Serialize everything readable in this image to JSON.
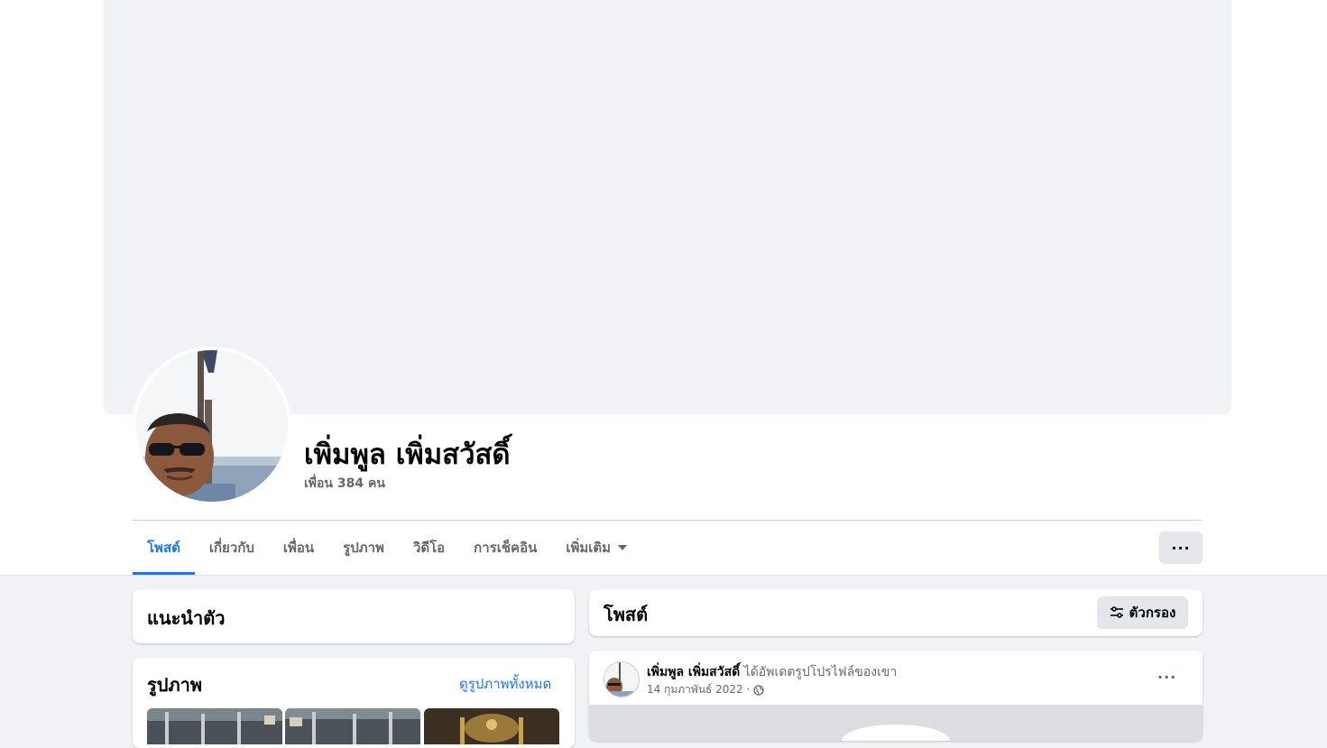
{
  "profile": {
    "name": "เพิ่มพูล เพิ่มสวัสดิ์",
    "friends": "เพื่อน 384 คน"
  },
  "tabs": [
    {
      "label": "โพสต์",
      "active": true
    },
    {
      "label": "เกี่ยวกับ",
      "active": false
    },
    {
      "label": "เพื่อน",
      "active": false
    },
    {
      "label": "รูปภาพ",
      "active": false
    },
    {
      "label": "วิดีโอ",
      "active": false
    },
    {
      "label": "การเช็คอิน",
      "active": false
    },
    {
      "label": "เพิ่มเติม",
      "active": false
    }
  ],
  "more_button": "···",
  "intro": {
    "title": "แนะนำตัว"
  },
  "photos": {
    "title": "รูปภาพ",
    "see_all": "ดูรูปภาพทั้งหมด"
  },
  "posts_header": {
    "title": "โพสต์",
    "filter_label": "ตัวกรอง"
  },
  "post": {
    "author": "เพิ่มพูล เพิ่มสวัสดิ์",
    "action": "ได้อัพเดตรูปโปรไฟล์ของเขา",
    "date": "14 กุมภาพันธ์ 2022 ·",
    "more": "···"
  },
  "colors": {
    "accent": "#1877f2",
    "page_bg": "#f0f2f5",
    "secondary_text": "#65676b"
  },
  "icons": {
    "filter": "sliders-icon",
    "privacy": "globe-icon",
    "tab_more": "caret-down-icon"
  }
}
